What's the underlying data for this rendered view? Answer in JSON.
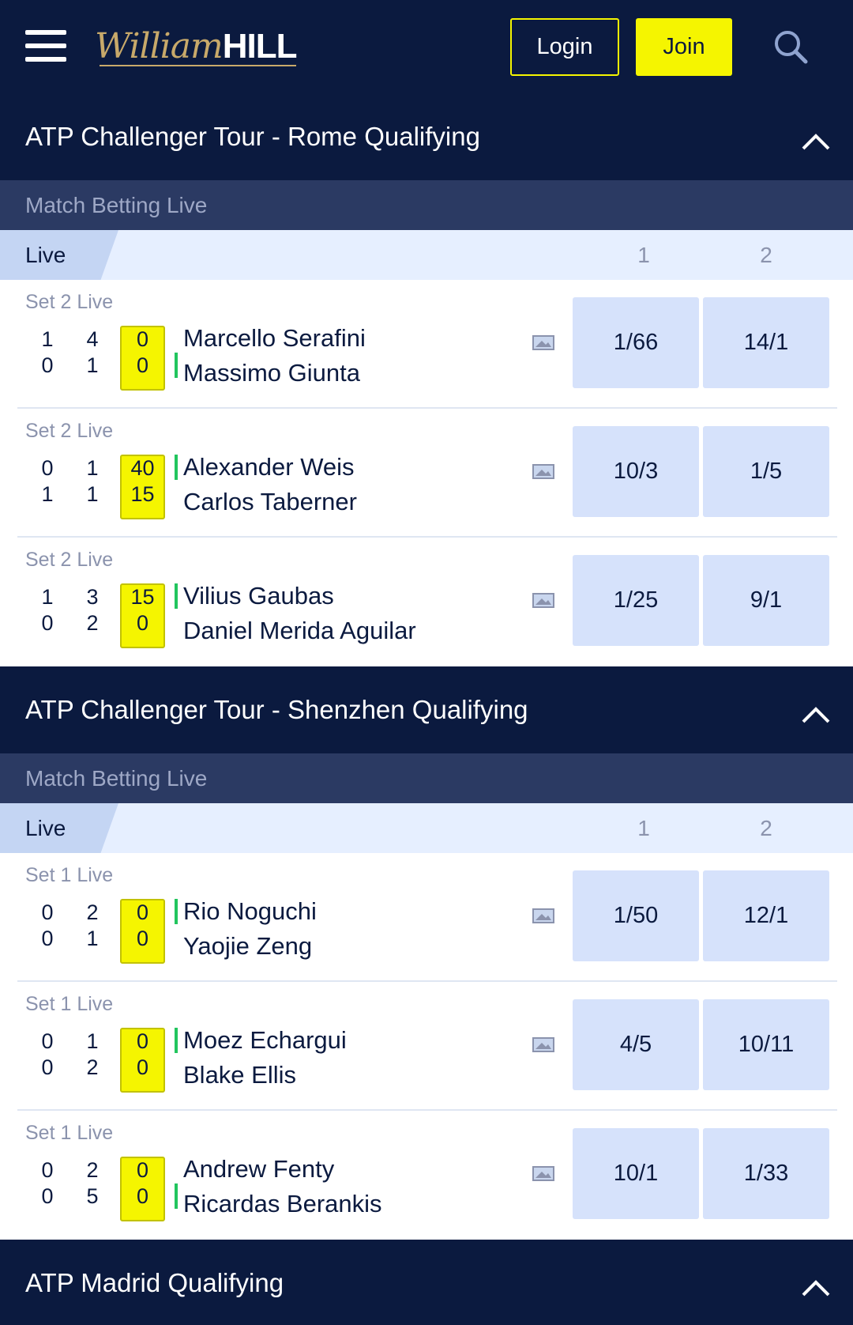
{
  "header": {
    "logo_script": "William",
    "logo_bold": "HILL",
    "login_label": "Login",
    "join_label": "Join"
  },
  "competitions": [
    {
      "title": "ATP Challenger Tour - Rome Qualifying",
      "market": "Match Betting Live",
      "live_label": "Live",
      "col1": "1",
      "col2": "2",
      "matches": [
        {
          "set": "Set 2 Live",
          "p1": "Marcello Serafini",
          "p2": "Massimo Giunta",
          "s1": [
            "1",
            "4"
          ],
          "s2": [
            "0",
            "1"
          ],
          "pt1": "0",
          "pt2": "0",
          "serve": 2,
          "odd1": "1/66",
          "odd2": "14/1"
        },
        {
          "set": "Set 2 Live",
          "p1": "Alexander Weis",
          "p2": "Carlos Taberner",
          "s1": [
            "0",
            "1"
          ],
          "s2": [
            "1",
            "1"
          ],
          "pt1": "40",
          "pt2": "15",
          "serve": 1,
          "odd1": "10/3",
          "odd2": "1/5"
        },
        {
          "set": "Set 2 Live",
          "p1": "Vilius Gaubas",
          "p2": "Daniel Merida Aguilar",
          "s1": [
            "1",
            "3"
          ],
          "s2": [
            "0",
            "2"
          ],
          "pt1": "15",
          "pt2": "0",
          "serve": 1,
          "odd1": "1/25",
          "odd2": "9/1"
        }
      ]
    },
    {
      "title": "ATP Challenger Tour - Shenzhen Qualifying",
      "market": "Match Betting Live",
      "live_label": "Live",
      "col1": "1",
      "col2": "2",
      "matches": [
        {
          "set": "Set 1 Live",
          "p1": "Rio Noguchi",
          "p2": "Yaojie Zeng",
          "s1": [
            "0",
            "2"
          ],
          "s2": [
            "0",
            "1"
          ],
          "pt1": "0",
          "pt2": "0",
          "serve": 1,
          "odd1": "1/50",
          "odd2": "12/1"
        },
        {
          "set": "Set 1 Live",
          "p1": "Moez Echargui",
          "p2": "Blake Ellis",
          "s1": [
            "0",
            "1"
          ],
          "s2": [
            "0",
            "2"
          ],
          "pt1": "0",
          "pt2": "0",
          "serve": 1,
          "odd1": "4/5",
          "odd2": "10/11"
        },
        {
          "set": "Set 1 Live",
          "p1": "Andrew Fenty",
          "p2": "Ricardas Berankis",
          "s1": [
            "0",
            "2"
          ],
          "s2": [
            "0",
            "5"
          ],
          "pt1": "0",
          "pt2": "0",
          "serve": 2,
          "odd1": "10/1",
          "odd2": "1/33"
        }
      ]
    },
    {
      "title": "ATP Madrid Qualifying"
    }
  ],
  "colors": {
    "navy": "#0b1a3f",
    "market_bar": "#2b3a63",
    "live_bg": "#e6efff",
    "odds_bg": "#d6e2fb",
    "yellow": "#f5f500",
    "serve_green": "#22c55e"
  },
  "icons": [
    "menu-icon",
    "search-icon",
    "chevron-up-icon",
    "tv-stream-icon"
  ]
}
